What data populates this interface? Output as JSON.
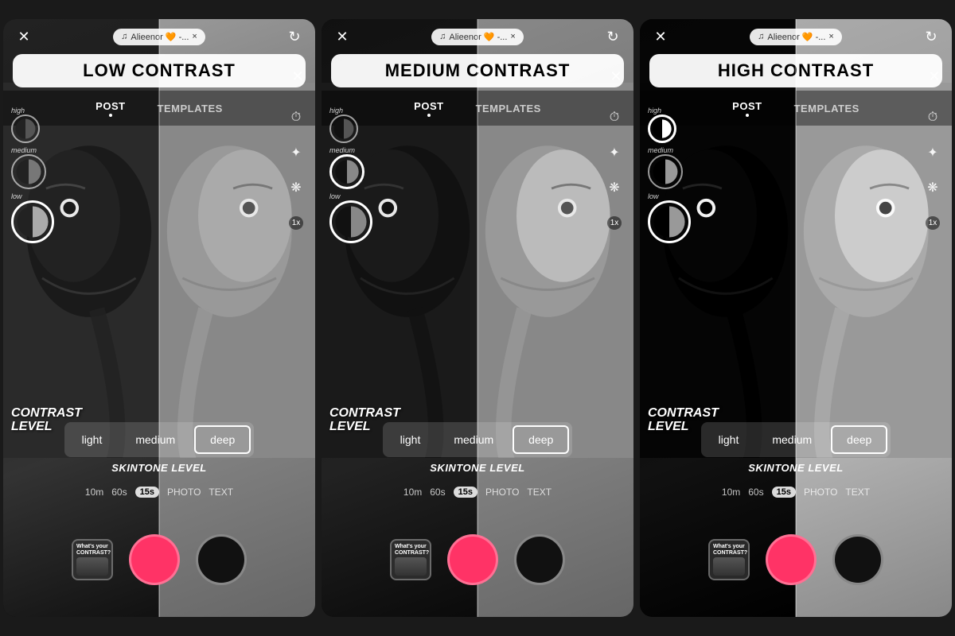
{
  "screens": [
    {
      "id": "low-contrast",
      "title": "LOW CONTRAST",
      "music_label": "Alieenor 🧡 -...",
      "contrast_level_text": "CONTRAST\nLEVEL",
      "skintone_options": [
        "light",
        "medium",
        "deep"
      ],
      "skintone_selected": "deep",
      "timer_options": [
        "10m",
        "60s",
        "15s",
        "PHOTO",
        "TEXT"
      ],
      "timer_active": "15s",
      "nav_items": [
        "POST",
        "TEMPLATES"
      ],
      "nav_active": "POST",
      "contrast_circles": [
        {
          "label": "high",
          "size": "small"
        },
        {
          "label": "medium",
          "size": "medium"
        },
        {
          "label": "low",
          "size": "large"
        }
      ],
      "colors": {
        "shutter_pink": "#ff3366",
        "bg_dark": "#1a1a1a"
      }
    },
    {
      "id": "medium-contrast",
      "title": "MEDIUM CONTRAST",
      "music_label": "Alieenor 🧡 -...",
      "contrast_level_text": "CONTRAST\nLEVEL",
      "skintone_options": [
        "light",
        "medium",
        "deep"
      ],
      "skintone_selected": "deep",
      "timer_options": [
        "10m",
        "60s",
        "15s",
        "PHOTO",
        "TEXT"
      ],
      "timer_active": "15s",
      "nav_items": [
        "POST",
        "TEMPLATES"
      ],
      "nav_active": "POST"
    },
    {
      "id": "high-contrast",
      "title": "HIGH CONTRAST",
      "music_label": "Alieenor 🧡 -...",
      "contrast_level_text": "CONTRAST\nLEVEL",
      "skintone_options": [
        "light",
        "medium",
        "deep"
      ],
      "skintone_selected": "deep",
      "timer_options": [
        "10m",
        "60s",
        "15s",
        "PHOTO",
        "TEXT"
      ],
      "timer_active": "15s",
      "nav_items": [
        "POST",
        "TEMPLATES"
      ],
      "nav_active": "POST"
    }
  ],
  "icons": {
    "close": "✕",
    "refresh": "↻",
    "timer": "⏱",
    "sparkle": "✦",
    "snowflake": "❄",
    "link": "⊕",
    "music_note": "♫",
    "x_small": "×"
  }
}
